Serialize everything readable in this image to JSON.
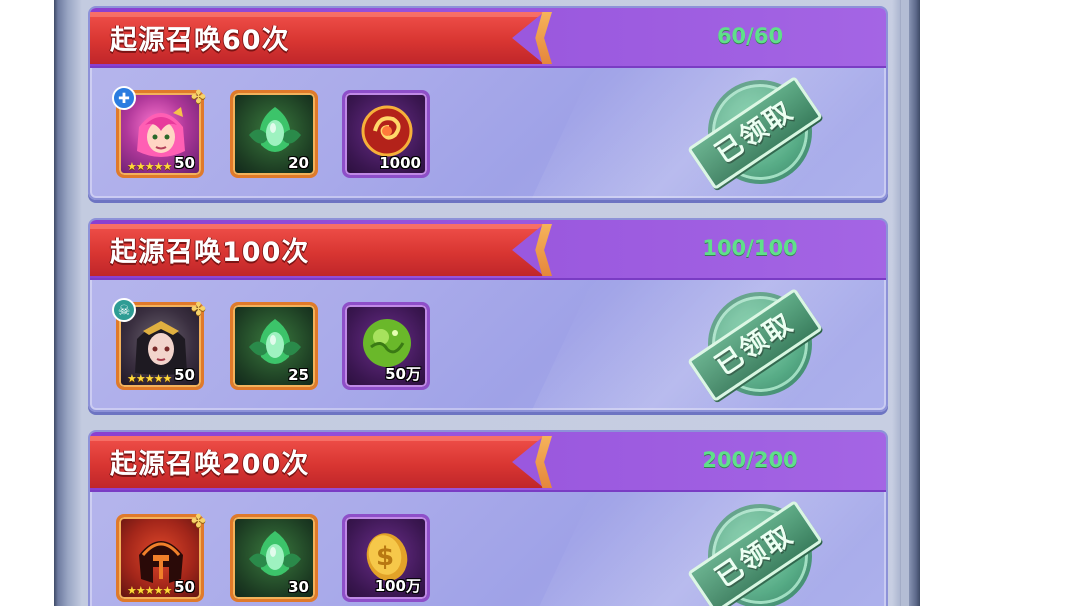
{
  "tasks": [
    {
      "title": "起源召唤60次",
      "progress": "60/60",
      "claimed_label": "已领取",
      "rewards": [
        {
          "kind": "hero",
          "icon": "hero-portrait-icon",
          "class_icon": "healer-class-icon",
          "count": "50",
          "stars": "★★★★★"
        },
        {
          "kind": "item",
          "icon": "green-leaf-crystal-icon",
          "count": "20"
        },
        {
          "kind": "item",
          "icon": "red-swirl-orb-icon",
          "count": "1000"
        }
      ]
    },
    {
      "title": "起源召唤100次",
      "progress": "100/100",
      "claimed_label": "已领取",
      "rewards": [
        {
          "kind": "hero",
          "icon": "hero-portrait-icon",
          "class_icon": "skull-class-icon",
          "count": "50",
          "stars": "★★★★★"
        },
        {
          "kind": "item",
          "icon": "green-leaf-crystal-icon",
          "count": "25"
        },
        {
          "kind": "item",
          "icon": "green-exp-orb-icon",
          "count": "50万"
        }
      ]
    },
    {
      "title": "起源召唤200次",
      "progress": "200/200",
      "claimed_label": "已领取",
      "rewards": [
        {
          "kind": "hero",
          "icon": "helmet-hero-icon",
          "count": "50",
          "stars": "★★★★★"
        },
        {
          "kind": "item",
          "icon": "green-leaf-crystal-icon",
          "count": "30"
        },
        {
          "kind": "item",
          "icon": "gold-coin-icon",
          "count": "100万"
        }
      ]
    }
  ],
  "colors": {
    "ribbon_red": "#d93632",
    "header_purple": "#9a58de",
    "progress_green": "#5fe08a",
    "stamp_green": "#3aa46a"
  }
}
